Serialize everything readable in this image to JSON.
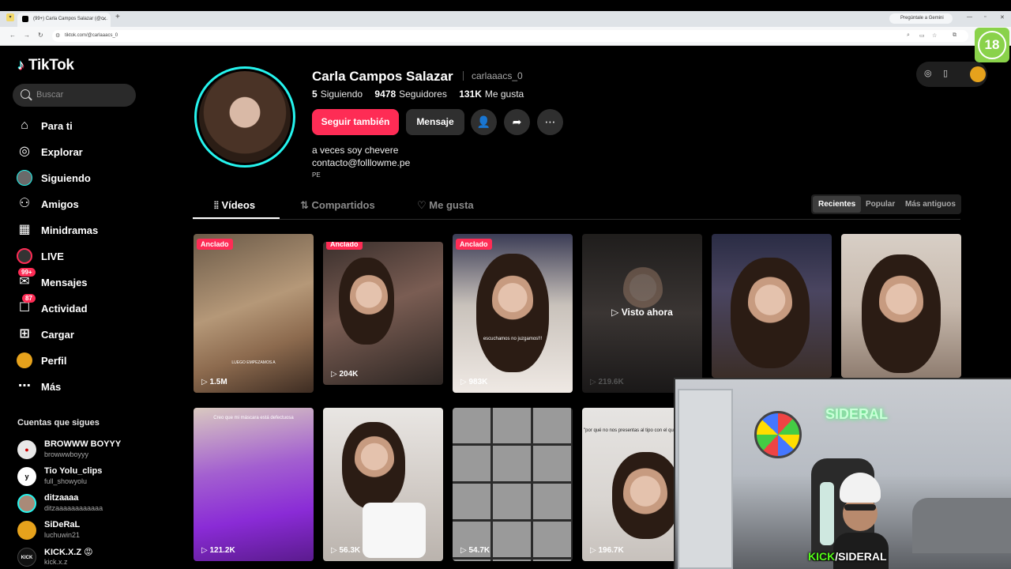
{
  "browser": {
    "tab_title": "(99+) Carla Campos Salazar (@c...",
    "url": "tiktok.com/@carlaaacs_0",
    "gemini_label": "Pregúntale a Gemini",
    "age_badge": "18"
  },
  "sidebar": {
    "logo": "TikTok",
    "search_placeholder": "Buscar",
    "items": [
      {
        "label": "Para ti",
        "icon": "home-icon"
      },
      {
        "label": "Explorar",
        "icon": "compass-icon"
      },
      {
        "label": "Siguiendo",
        "icon": "following-avatar"
      },
      {
        "label": "Amigos",
        "icon": "friends-icon"
      },
      {
        "label": "Minidramas",
        "icon": "film-icon"
      },
      {
        "label": "LIVE",
        "icon": "live-icon"
      },
      {
        "label": "Mensajes",
        "icon": "message-icon",
        "badge": "99+"
      },
      {
        "label": "Actividad",
        "icon": "bell-icon",
        "badge": "87"
      },
      {
        "label": "Cargar",
        "icon": "upload-icon"
      },
      {
        "label": "Perfil",
        "icon": "profile-avatar"
      },
      {
        "label": "Más",
        "icon": "more-icon"
      }
    ],
    "following_title": "Cuentas que sigues",
    "following": [
      {
        "name": "BROWWW BOYYY",
        "user": "browwwboyyy"
      },
      {
        "name": "Tio Yolu_clips",
        "user": "full_showyolu"
      },
      {
        "name": "ditzaaaa",
        "user": "ditzaaaaaaaaaaaa"
      },
      {
        "name": "SiDeRaL",
        "user": "luchuwin21"
      },
      {
        "name": "KICK.X.Z 😡",
        "user": "kick.x.z"
      }
    ]
  },
  "profile": {
    "name": "Carla Campos Salazar",
    "handle": "carlaaacs_0",
    "following_count": "5",
    "following_label": "Siguiendo",
    "followers_count": "9478",
    "followers_label": "Seguidores",
    "likes_count": "131K",
    "likes_label": "Me gusta",
    "follow_back_label": "Seguir también",
    "message_label": "Mensaje",
    "bio_line1": "a veces soy chevere",
    "bio_line2": "contacto@folllowme.pe",
    "region": "PE"
  },
  "tabs": [
    "Vídeos",
    "Compartidos",
    "Me gusta"
  ],
  "sort": [
    "Recientes",
    "Popular",
    "Más antiguos"
  ],
  "videos": [
    {
      "views": "1.5M",
      "pinned": "Anclado",
      "caption": "LUEGO EMPEZAMOS A"
    },
    {
      "views": "204K",
      "pinned": "Anclado",
      "caption": ""
    },
    {
      "views": "983K",
      "pinned": "Anclado",
      "caption": "escuchamos no juzgamos!!!"
    },
    {
      "views": "219.6K",
      "watched": "Visto ahora",
      "caption": ""
    },
    {
      "views": "",
      "caption": ""
    },
    {
      "views": "",
      "caption": ""
    },
    {
      "views": "121.2K",
      "caption": "Creo que mi máscara está defectuosa"
    },
    {
      "views": "56.3K",
      "caption": ""
    },
    {
      "views": "54.7K",
      "caption": ""
    },
    {
      "views": "196.7K",
      "caption": "\"por qué no nos presentas al tipo con el que sales?\" yo:"
    }
  ],
  "webcam": {
    "brand_kick": "KICK",
    "brand_rest": "/SIDERAL",
    "neon_sign": "SIDERAL"
  }
}
